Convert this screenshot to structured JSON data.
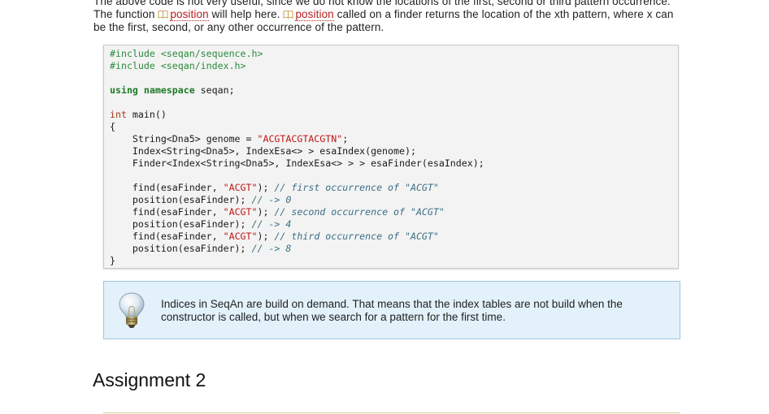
{
  "intro": {
    "text_1": "The above code is not very useful, since we do not know the locations of the first, second or third pattern occurrence. The function ",
    "link_1": "position",
    "text_2": " will help here. ",
    "link_2": "position",
    "text_3": " called on a finder returns the location of the xth pattern, where x can be the first, second, or any other occurrence of the pattern.",
    "link_icon": "book-icon",
    "link_color": "#b51d1d"
  },
  "code": {
    "include_1": "#include <seqan/sequence.h>",
    "include_2": "#include <seqan/index.h>",
    "using_kw": "using namespace",
    "using_ns": " seqan;",
    "int_kw": "int",
    "main_sig": " main()",
    "open_brace": "{",
    "l1_a": "    String<Dna5> genome = ",
    "l1_str": "\"ACGTACGTACGTN\"",
    "l1_b": ";",
    "l2": "    Index<String<Dna5>, IndexEsa<> > esaIndex(genome);",
    "l3": "    Finder<Index<String<Dna5>, IndexEsa<> > > esaFinder(esaIndex);",
    "f1_a": "    find(esaFinder, ",
    "f1_str": "\"ACGT\"",
    "f1_b": "); ",
    "f1_cm": "// first occurrence of \"ACGT\"",
    "p1_a": "    position(esaFinder); ",
    "p1_cm": "// -> 0",
    "f2_a": "    find(esaFinder, ",
    "f2_str": "\"ACGT\"",
    "f2_b": "); ",
    "f2_cm": "// second occurrence of \"ACGT\"",
    "p2_a": "    position(esaFinder); ",
    "p2_cm": "// -> 4",
    "f3_a": "    find(esaFinder, ",
    "f3_str": "\"ACGT\"",
    "f3_b": "); ",
    "f3_cm": "// third occurrence of \"ACGT\"",
    "p3_a": "    position(esaFinder); ",
    "p3_cm": "// -> 8",
    "close_brace": "}"
  },
  "note": {
    "icon": "lightbulb-icon",
    "text": "Indices in SeqAn are build on demand. That means that the index tables are not build when the constructor is called, but when we search for a pattern for the first time.",
    "bg_color": "#e2f1fa"
  },
  "heading": {
    "text": "Assignment 2"
  }
}
